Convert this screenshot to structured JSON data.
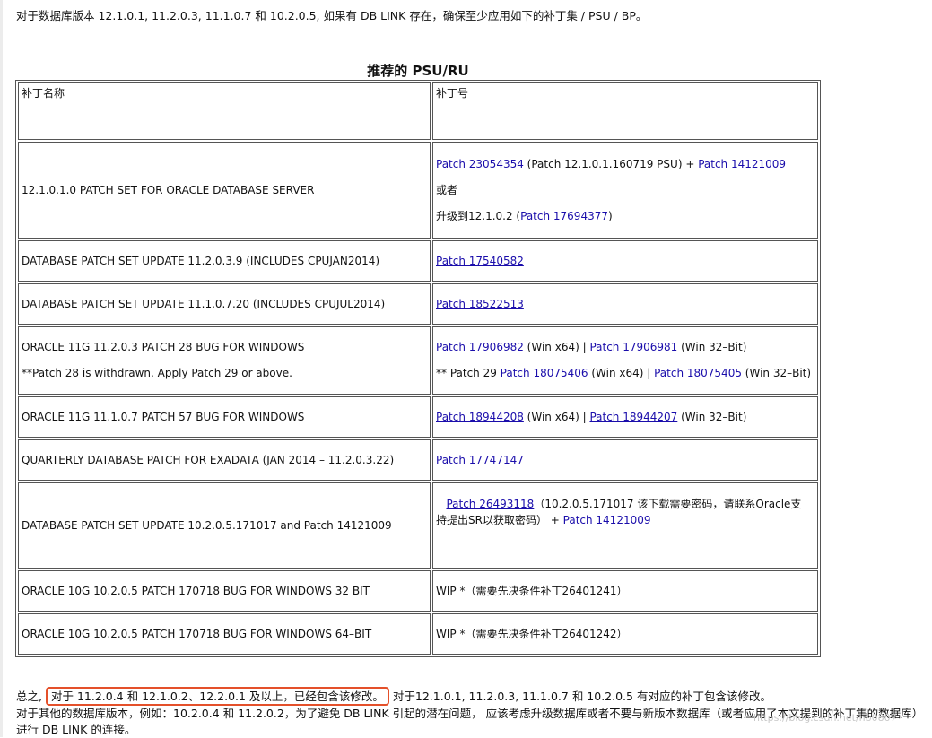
{
  "intro": "对于数据库版本 12.1.0.1, 11.2.0.3, 11.1.0.7 和 10.2.0.5, 如果有 DB LINK 存在，确保至少应用如下的补丁集 / PSU / BP。",
  "table": {
    "caption": "推荐的 PSU/RU",
    "headers": [
      "补丁名称",
      "补丁号"
    ],
    "rows": [
      {
        "name": "12.1.0.1.0 PATCH SET FOR ORACLE DATABASE SERVER",
        "l1_link1": "Patch 23054354",
        "l1_mid": " (Patch 12.1.0.1.160719 PSU) + ",
        "l1_link2": "Patch 14121009",
        "l2": "或者",
        "l3_pre": "升级到12.1.0.2 (",
        "l3_link": "Patch 17694377",
        "l3_post": ")"
      },
      {
        "name": "DATABASE PATCH SET UPDATE 11.2.0.3.9 (INCLUDES CPUJAN2014)",
        "link": "Patch 17540582"
      },
      {
        "name": "DATABASE PATCH SET UPDATE 11.1.0.7.20 (INCLUDES CPUJUL2014)",
        "link": "Patch 18522513"
      },
      {
        "name": "ORACLE 11G 11.2.0.3 PATCH 28 BUG FOR WINDOWS",
        "note": "**Patch 28 is withdrawn. Apply Patch 29 or above.",
        "l1_link1": "Patch 17906982",
        "l1_mid": " (Win x64) | ",
        "l1_link2": "Patch 17906981",
        "l1_post": " (Win 32–Bit)",
        "l2_pre": "** Patch 29 ",
        "l2_link1": "Patch 18075406",
        "l2_mid": " (Win x64) | ",
        "l2_link2": "Patch 18075405",
        "l2_post": " (Win 32–Bit)"
      },
      {
        "name": "ORACLE 11G 11.1.0.7 PATCH 57 BUG FOR WINDOWS",
        "link1": "Patch 18944208",
        "mid": " (Win x64) | ",
        "link2": "Patch 18944207",
        "post": " (Win 32–Bit)"
      },
      {
        "name": "QUARTERLY DATABASE PATCH FOR EXADATA (JAN 2014 – 11.2.0.3.22)",
        "link": "Patch 17747147"
      },
      {
        "name": "DATABASE PATCH SET UPDATE 10.2.0.5.171017 and Patch 14121009",
        "link1": "Patch 26493118",
        "mid1": "（10.2.0.5.171017 该下载需要密码，请联系Oracle支",
        "mid2": "持提出SR以获取密码）  + ",
        "link2": "Patch 14121009"
      },
      {
        "name": "ORACLE 10G 10.2.0.5 PATCH 170718 BUG FOR WINDOWS 32 BIT",
        "value": "WIP *（需要先决条件补丁26401241）"
      },
      {
        "name": "ORACLE 10G 10.2.0.5 PATCH 170718 BUG FOR WINDOWS 64–BIT",
        "value": "WIP *（需要先决条件补丁26401242）"
      }
    ]
  },
  "summary": {
    "prefix": "总之,",
    "highlight": "对于 11.2.0.4 和 12.1.0.2、12.2.0.1 及以上，已经包含该修改。",
    "suffix": "对于12.1.0.1, 11.2.0.3, 11.1.0.7 和 10.2.0.5 有对应的补丁包含该修改。"
  },
  "followup": "对于其他的数据库版本，例如：10.2.0.4 和 11.2.0.2，为了避免 DB LINK 引起的潜在问题， 应该考虑升级数据库或者不要与新版本数据库（或者应用了本文提到的补丁集的数据库）进行 DB LINK 的连接。",
  "watermark": "https://blog.csdn.net/hb0807",
  "colors": {
    "link": "#1a0dab",
    "highlight_border": "#e4502a",
    "border": "#555555"
  }
}
